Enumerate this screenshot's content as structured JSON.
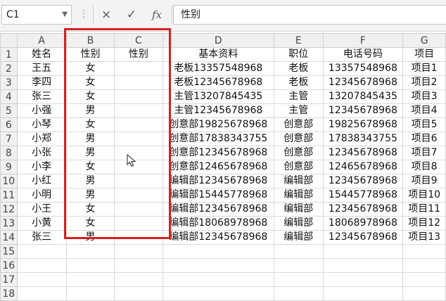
{
  "formula_bar": {
    "name_box": "C1",
    "name_box_dropdown": "chevron-down-icon",
    "cancel_icon": "×",
    "confirm_icon": "✓",
    "function_icon": "fx",
    "formula": "性别"
  },
  "columns": [
    "A",
    "B",
    "C",
    "D",
    "E",
    "F",
    "G"
  ],
  "rows": [
    {
      "n": "1",
      "a": "姓名",
      "b": "性别",
      "c": "性别",
      "d": "基本资料",
      "e": "职位",
      "f": "电话号码",
      "g": "项目"
    },
    {
      "n": "2",
      "a": "王五",
      "b": "女",
      "c": "",
      "d": "老板13357548968",
      "e": "老板",
      "f": "13357548968",
      "g": "项目1"
    },
    {
      "n": "3",
      "a": "李四",
      "b": "女",
      "c": "",
      "d": "老板12345678968",
      "e": "老板",
      "f": "12345678968",
      "g": "项目2"
    },
    {
      "n": "4",
      "a": "张三",
      "b": "女",
      "c": "",
      "d": "主管13207845435",
      "e": "主管",
      "f": "13207845435",
      "g": "项目3"
    },
    {
      "n": "5",
      "a": "小强",
      "b": "男",
      "c": "",
      "d": "主管12345678968",
      "e": "主管",
      "f": "12345678968",
      "g": "项目4"
    },
    {
      "n": "6",
      "a": "小琴",
      "b": "女",
      "c": "",
      "d": "创意部19825678968",
      "e": "创意部",
      "f": "19825678968",
      "g": "项目5"
    },
    {
      "n": "7",
      "a": "小郑",
      "b": "男",
      "c": "",
      "d": "创意部17838343755",
      "e": "创意部",
      "f": "17838343755",
      "g": "项目6"
    },
    {
      "n": "8",
      "a": "小张",
      "b": "男",
      "c": "",
      "d": "创意部12345678968",
      "e": "创意部",
      "f": "12345678968",
      "g": "项目7"
    },
    {
      "n": "9",
      "a": "小李",
      "b": "女",
      "c": "",
      "d": "创意部12465678968",
      "e": "创意部",
      "f": "12465678968",
      "g": "项目8"
    },
    {
      "n": "10",
      "a": "小红",
      "b": "男",
      "c": "",
      "d": "编辑部12345678968",
      "e": "编辑部",
      "f": "12345678968",
      "g": "项目9"
    },
    {
      "n": "11",
      "a": "小明",
      "b": "男",
      "c": "",
      "d": "编辑部15445778968",
      "e": "编辑部",
      "f": "15445778968",
      "g": "项目10"
    },
    {
      "n": "12",
      "a": "小王",
      "b": "女",
      "c": "",
      "d": "编辑部12345678968",
      "e": "编辑部",
      "f": "12345678968",
      "g": "项目11"
    },
    {
      "n": "13",
      "a": "小黄",
      "b": "女",
      "c": "",
      "d": "编辑部18068978968",
      "e": "编辑部",
      "f": "18068978968",
      "g": "项目12"
    },
    {
      "n": "14",
      "a": "张三",
      "b": "男",
      "c": "",
      "d": "编辑部12345678968",
      "e": "编辑部",
      "f": "12345678968",
      "g": "项目13"
    },
    {
      "n": "15",
      "a": "",
      "b": "",
      "c": "",
      "d": "",
      "e": "",
      "f": "",
      "g": ""
    },
    {
      "n": "16",
      "a": "",
      "b": "",
      "c": "",
      "d": "",
      "e": "",
      "f": "",
      "g": ""
    },
    {
      "n": "17",
      "a": "",
      "b": "",
      "c": "",
      "d": "",
      "e": "",
      "f": "",
      "g": ""
    },
    {
      "n": "18",
      "a": "",
      "b": "",
      "c": "",
      "d": "",
      "e": "",
      "f": "",
      "g": ""
    }
  ],
  "colors": {
    "selection_border": "#d42121",
    "header_bg": "#f0f0f0",
    "gridline": "#d9d9d9"
  }
}
